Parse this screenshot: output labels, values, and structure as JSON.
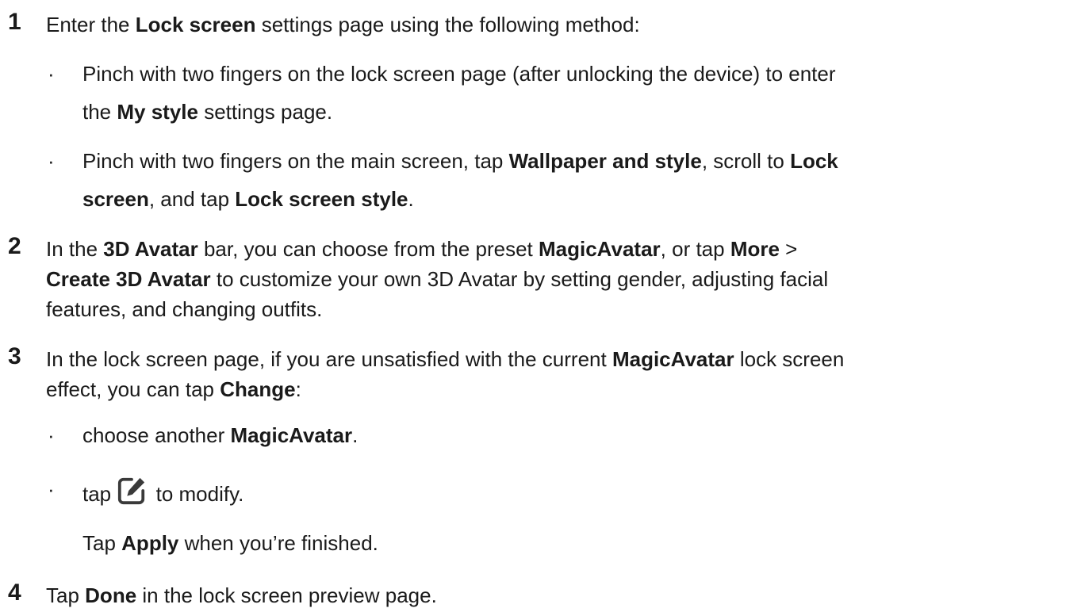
{
  "steps": [
    {
      "number": "1",
      "intro": {
        "t1": "Enter the ",
        "b1": "Lock screen",
        "t2": " settings page using the following method:"
      },
      "bullets": [
        {
          "line1": {
            "t1": "Pinch with two fingers on the lock screen page (after unlocking the device) to enter"
          },
          "line2": {
            "t1": "the ",
            "b1": "My style",
            "t2": " settings page."
          }
        },
        {
          "line1": {
            "t1": "Pinch with two fingers on the main screen, tap ",
            "b1": "Wallpaper and style",
            "t2": ", scroll to ",
            "b2": "Lock"
          },
          "line2": {
            "b1": "screen",
            "t1": ", and tap ",
            "b2": "Lock screen style",
            "t2": "."
          }
        }
      ]
    },
    {
      "number": "2",
      "line1": {
        "t1": "In the ",
        "b1": "3D Avatar",
        "t2": " bar, you can choose from the preset ",
        "b2": "MagicAvatar",
        "t3": ", or tap ",
        "b3": "More",
        "t4": " >"
      },
      "line2": {
        "b1": "Create 3D Avatar",
        "t1": " to customize your own 3D Avatar by setting gender, adjusting facial"
      },
      "line3": {
        "t1": "features, and changing outfits."
      }
    },
    {
      "number": "3",
      "line1": {
        "t1": "In the lock screen page, if you are unsatisfied with the current ",
        "b1": "MagicAvatar",
        "t2": " lock screen"
      },
      "line2": {
        "t1": "effect, you can tap ",
        "b1": "Change",
        "t2": ":"
      },
      "bullets": [
        {
          "t1": "choose another ",
          "b1": "MagicAvatar",
          "t2": "."
        },
        {
          "t1": "tap ",
          "icon": "edit-icon",
          "t2": " to modify."
        }
      ],
      "after": {
        "t1": "Tap ",
        "b1": "Apply",
        "t2": " when you’re finished."
      }
    },
    {
      "number": "4",
      "line1": {
        "t1": "Tap ",
        "b1": "Done",
        "t2": " in the lock screen preview page."
      }
    }
  ],
  "bullet_glyph": "·",
  "colors": {
    "text": "#1a1a1a",
    "icon": "#3a3a3a"
  }
}
